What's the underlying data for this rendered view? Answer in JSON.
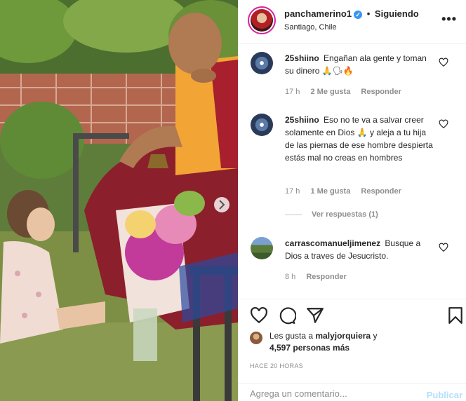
{
  "post": {
    "author": "panchamerino1",
    "follow_status": "Siguiendo",
    "separator": "•",
    "location": "Santiago, Chile",
    "verified_glyph": "✓"
  },
  "comments": [
    {
      "user": "25shiino",
      "text": "Engañan ala gente y toman su dinero 🙏🗣🔥",
      "time": "17 h",
      "likes": "2 Me gusta",
      "reply": "Responder"
    },
    {
      "user": "25shiino",
      "text": "Eso no te va a salvar creer solamente en Dios 🙏 y aleja a tu hija de las piernas de ese hombre despierta estás mal no creas en hombres",
      "time": "17 h",
      "likes": "1 Me gusta",
      "reply": "Responder"
    },
    {
      "user": "carrascomanueljimenez",
      "text": "Busque a Dios a traves de Jesucristo.",
      "time": "8 h",
      "reply": "Responder"
    }
  ],
  "view_replies": "Ver respuestas (1)",
  "likes": {
    "prefix": "Les gusta a",
    "user": "malyjorquiera",
    "connector": "y",
    "others": "4,597 personas más"
  },
  "timestamp": "HACE 20 HORAS",
  "composer": {
    "placeholder": "Agrega un comentario...",
    "publish": "Publicar"
  },
  "icons": {
    "more": "more-options-icon",
    "like": "heart-icon",
    "comment": "comment-bubble-icon",
    "share": "paper-plane-icon",
    "save": "bookmark-icon"
  },
  "colors": {
    "verified": "#3897f0",
    "secondary_text": "#8e8e8e",
    "publish_disabled": "#b2dffc"
  }
}
